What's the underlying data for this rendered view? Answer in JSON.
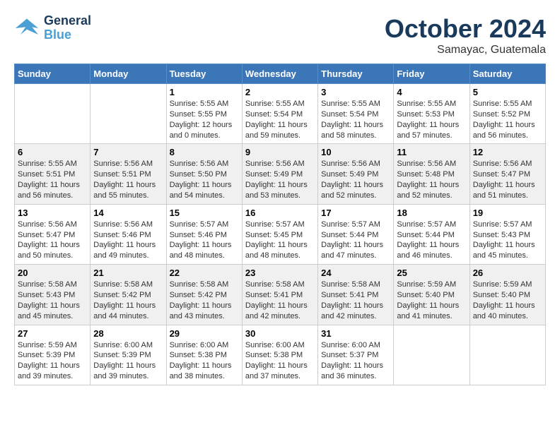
{
  "header": {
    "logo": {
      "line1": "General",
      "line2": "Blue"
    },
    "title": "October 2024",
    "subtitle": "Samayac, Guatemala"
  },
  "weekdays": [
    "Sunday",
    "Monday",
    "Tuesday",
    "Wednesday",
    "Thursday",
    "Friday",
    "Saturday"
  ],
  "weeks": [
    [
      {
        "day": null,
        "info": null
      },
      {
        "day": null,
        "info": null
      },
      {
        "day": "1",
        "info": "Sunrise: 5:55 AM\nSunset: 5:55 PM\nDaylight: 12 hours\nand 0 minutes."
      },
      {
        "day": "2",
        "info": "Sunrise: 5:55 AM\nSunset: 5:54 PM\nDaylight: 11 hours\nand 59 minutes."
      },
      {
        "day": "3",
        "info": "Sunrise: 5:55 AM\nSunset: 5:54 PM\nDaylight: 11 hours\nand 58 minutes."
      },
      {
        "day": "4",
        "info": "Sunrise: 5:55 AM\nSunset: 5:53 PM\nDaylight: 11 hours\nand 57 minutes."
      },
      {
        "day": "5",
        "info": "Sunrise: 5:55 AM\nSunset: 5:52 PM\nDaylight: 11 hours\nand 56 minutes."
      }
    ],
    [
      {
        "day": "6",
        "info": "Sunrise: 5:55 AM\nSunset: 5:51 PM\nDaylight: 11 hours\nand 56 minutes."
      },
      {
        "day": "7",
        "info": "Sunrise: 5:56 AM\nSunset: 5:51 PM\nDaylight: 11 hours\nand 55 minutes."
      },
      {
        "day": "8",
        "info": "Sunrise: 5:56 AM\nSunset: 5:50 PM\nDaylight: 11 hours\nand 54 minutes."
      },
      {
        "day": "9",
        "info": "Sunrise: 5:56 AM\nSunset: 5:49 PM\nDaylight: 11 hours\nand 53 minutes."
      },
      {
        "day": "10",
        "info": "Sunrise: 5:56 AM\nSunset: 5:49 PM\nDaylight: 11 hours\nand 52 minutes."
      },
      {
        "day": "11",
        "info": "Sunrise: 5:56 AM\nSunset: 5:48 PM\nDaylight: 11 hours\nand 52 minutes."
      },
      {
        "day": "12",
        "info": "Sunrise: 5:56 AM\nSunset: 5:47 PM\nDaylight: 11 hours\nand 51 minutes."
      }
    ],
    [
      {
        "day": "13",
        "info": "Sunrise: 5:56 AM\nSunset: 5:47 PM\nDaylight: 11 hours\nand 50 minutes."
      },
      {
        "day": "14",
        "info": "Sunrise: 5:56 AM\nSunset: 5:46 PM\nDaylight: 11 hours\nand 49 minutes."
      },
      {
        "day": "15",
        "info": "Sunrise: 5:57 AM\nSunset: 5:46 PM\nDaylight: 11 hours\nand 48 minutes."
      },
      {
        "day": "16",
        "info": "Sunrise: 5:57 AM\nSunset: 5:45 PM\nDaylight: 11 hours\nand 48 minutes."
      },
      {
        "day": "17",
        "info": "Sunrise: 5:57 AM\nSunset: 5:44 PM\nDaylight: 11 hours\nand 47 minutes."
      },
      {
        "day": "18",
        "info": "Sunrise: 5:57 AM\nSunset: 5:44 PM\nDaylight: 11 hours\nand 46 minutes."
      },
      {
        "day": "19",
        "info": "Sunrise: 5:57 AM\nSunset: 5:43 PM\nDaylight: 11 hours\nand 45 minutes."
      }
    ],
    [
      {
        "day": "20",
        "info": "Sunrise: 5:58 AM\nSunset: 5:43 PM\nDaylight: 11 hours\nand 45 minutes."
      },
      {
        "day": "21",
        "info": "Sunrise: 5:58 AM\nSunset: 5:42 PM\nDaylight: 11 hours\nand 44 minutes."
      },
      {
        "day": "22",
        "info": "Sunrise: 5:58 AM\nSunset: 5:42 PM\nDaylight: 11 hours\nand 43 minutes."
      },
      {
        "day": "23",
        "info": "Sunrise: 5:58 AM\nSunset: 5:41 PM\nDaylight: 11 hours\nand 42 minutes."
      },
      {
        "day": "24",
        "info": "Sunrise: 5:58 AM\nSunset: 5:41 PM\nDaylight: 11 hours\nand 42 minutes."
      },
      {
        "day": "25",
        "info": "Sunrise: 5:59 AM\nSunset: 5:40 PM\nDaylight: 11 hours\nand 41 minutes."
      },
      {
        "day": "26",
        "info": "Sunrise: 5:59 AM\nSunset: 5:40 PM\nDaylight: 11 hours\nand 40 minutes."
      }
    ],
    [
      {
        "day": "27",
        "info": "Sunrise: 5:59 AM\nSunset: 5:39 PM\nDaylight: 11 hours\nand 39 minutes."
      },
      {
        "day": "28",
        "info": "Sunrise: 6:00 AM\nSunset: 5:39 PM\nDaylight: 11 hours\nand 39 minutes."
      },
      {
        "day": "29",
        "info": "Sunrise: 6:00 AM\nSunset: 5:38 PM\nDaylight: 11 hours\nand 38 minutes."
      },
      {
        "day": "30",
        "info": "Sunrise: 6:00 AM\nSunset: 5:38 PM\nDaylight: 11 hours\nand 37 minutes."
      },
      {
        "day": "31",
        "info": "Sunrise: 6:00 AM\nSunset: 5:37 PM\nDaylight: 11 hours\nand 36 minutes."
      },
      {
        "day": null,
        "info": null
      },
      {
        "day": null,
        "info": null
      }
    ]
  ]
}
